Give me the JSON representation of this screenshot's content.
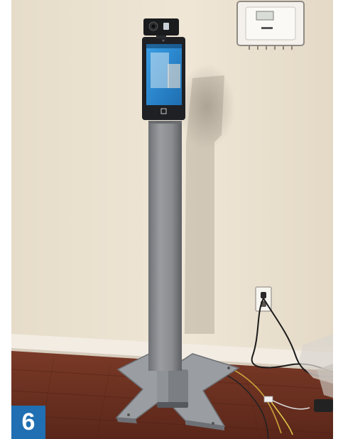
{
  "figure": {
    "badge_number": "6",
    "colors": {
      "badge": "#1f6fb2",
      "wall": "#e9e0cf",
      "floor": "#6e3324",
      "pole": "#8d8f93",
      "screen": "#2d8fd6"
    }
  }
}
